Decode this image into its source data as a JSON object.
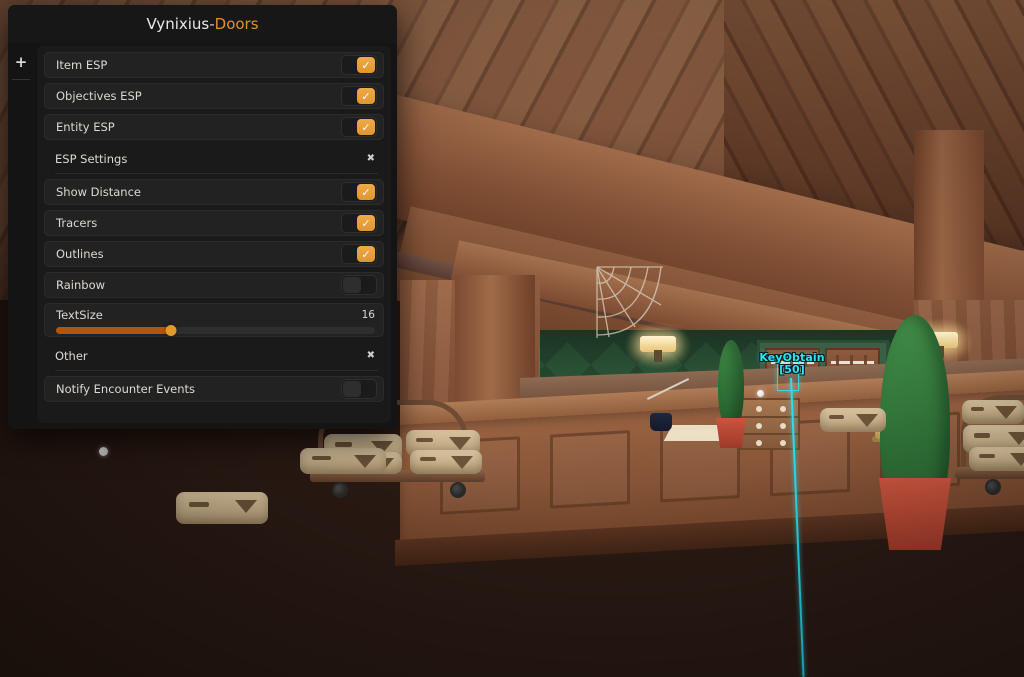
{
  "window": {
    "title_main": "Vynixius",
    "title_separator": " - ",
    "title_game": "Doors",
    "accent_color": "#e0912f",
    "panel_background": "#141414",
    "content_background": "#1a1a1a"
  },
  "tab_rail": {
    "add_tab_label": "+"
  },
  "toggles": [
    {
      "label": "Item ESP",
      "state": "on",
      "check": "✓"
    },
    {
      "label": "Objectives ESP",
      "state": "on",
      "check": "✓"
    },
    {
      "label": "Entity ESP",
      "state": "on",
      "check": "✓"
    }
  ],
  "sections": [
    {
      "title": "ESP Settings",
      "close_label": "✖",
      "toggles": [
        {
          "label": "Show Distance",
          "state": "on",
          "check": "✓"
        },
        {
          "label": "Tracers",
          "state": "on",
          "check": "✓"
        },
        {
          "label": "Outlines",
          "state": "on",
          "check": "✓"
        },
        {
          "label": "Rainbow",
          "state": "off",
          "check": "✓"
        }
      ],
      "slider": {
        "label": "TextSize",
        "value": "16",
        "fill_percent": 36,
        "fill_color": "#b5540d",
        "knob_color": "#e09a2c"
      }
    },
    {
      "title": "Other",
      "close_label": "✖",
      "toggles": [
        {
          "label": "Notify Encounter Events",
          "state": "off",
          "check": "✓"
        }
      ]
    }
  ],
  "esp_overlay": {
    "target_name": "KeyObtain",
    "target_distance": "[50]",
    "color": "#2fe4f2"
  }
}
